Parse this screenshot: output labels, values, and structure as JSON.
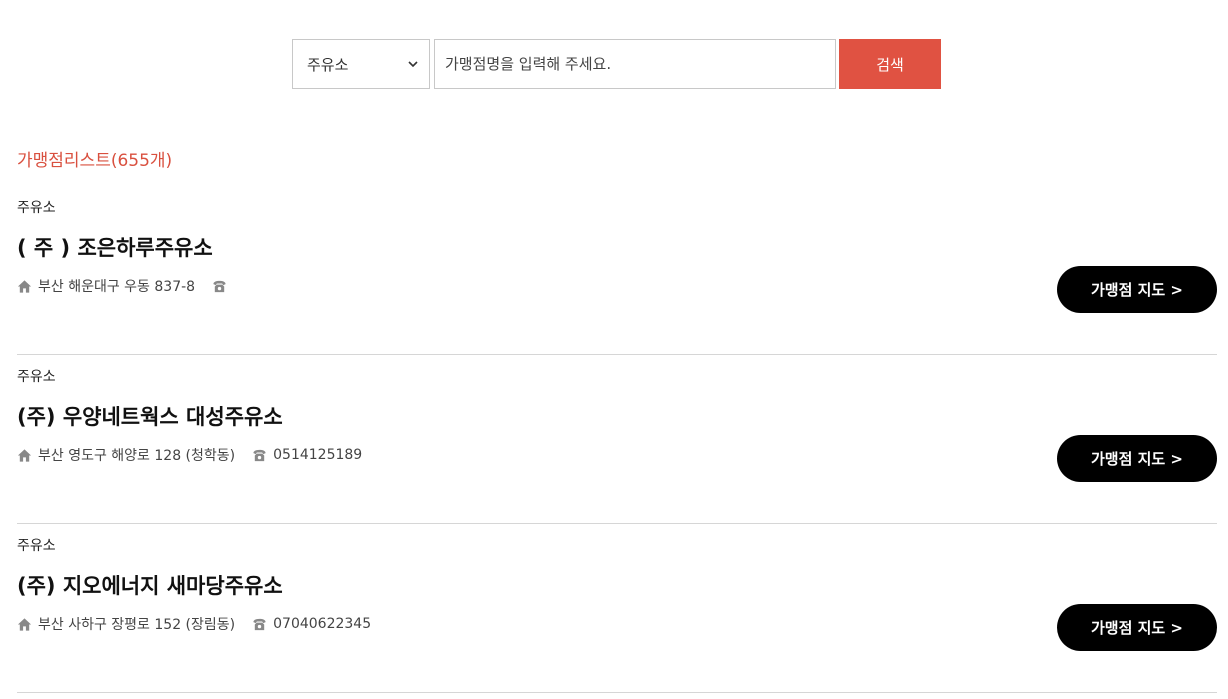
{
  "search": {
    "category_selected": "주유소",
    "input_placeholder": "가맹점명을 입력해 주세요.",
    "button_label": "검색"
  },
  "list": {
    "heading": "가맹점리스트(655개)",
    "items": [
      {
        "category": "주유소",
        "name": "( 주 ) 조은하루주유소",
        "address": "부산 해운대구 우동 837-8",
        "phone": "",
        "map_button": "가맹점 지도 >"
      },
      {
        "category": "주유소",
        "name": "(주) 우양네트웍스 대성주유소",
        "address": "부산 영도구 해양로 128 (청학동)",
        "phone": "0514125189",
        "map_button": "가맹점 지도 >"
      },
      {
        "category": "주유소",
        "name": "(주) 지오에너지 새마당주유소",
        "address": "부산 사하구 장평로 152 (장림동)",
        "phone": "07040622345",
        "map_button": "가맹점 지도 >"
      }
    ]
  },
  "colors": {
    "accent": "#e05242",
    "heading": "#d9503f",
    "map_button": "#000000",
    "divider": "#d6d6d6",
    "icon": "#888888"
  }
}
